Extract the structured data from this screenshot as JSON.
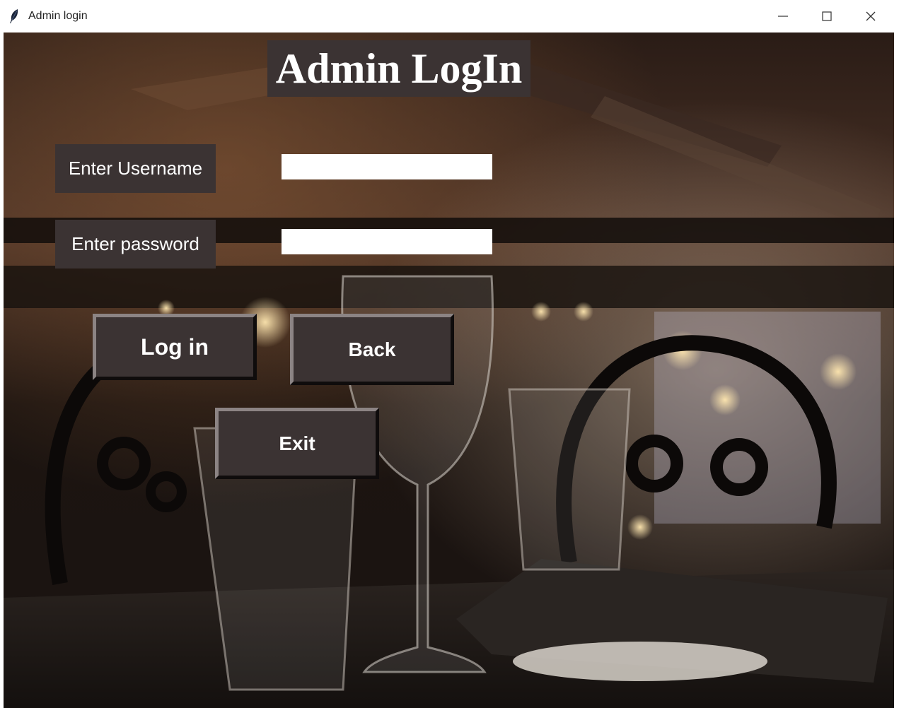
{
  "window": {
    "title": "Admin login",
    "controls": [
      "minimize-icon",
      "maximize-icon",
      "close-icon"
    ]
  },
  "heading": "Admin LogIn",
  "form": {
    "username_label": "Enter Username",
    "username_value": "",
    "password_label": "Enter password",
    "password_value": ""
  },
  "buttons": {
    "login": "Log in",
    "back": "Back",
    "exit": "Exit"
  },
  "colors": {
    "panel": "#3b3333",
    "text": "#ffffff",
    "entry": "#ffffff"
  }
}
